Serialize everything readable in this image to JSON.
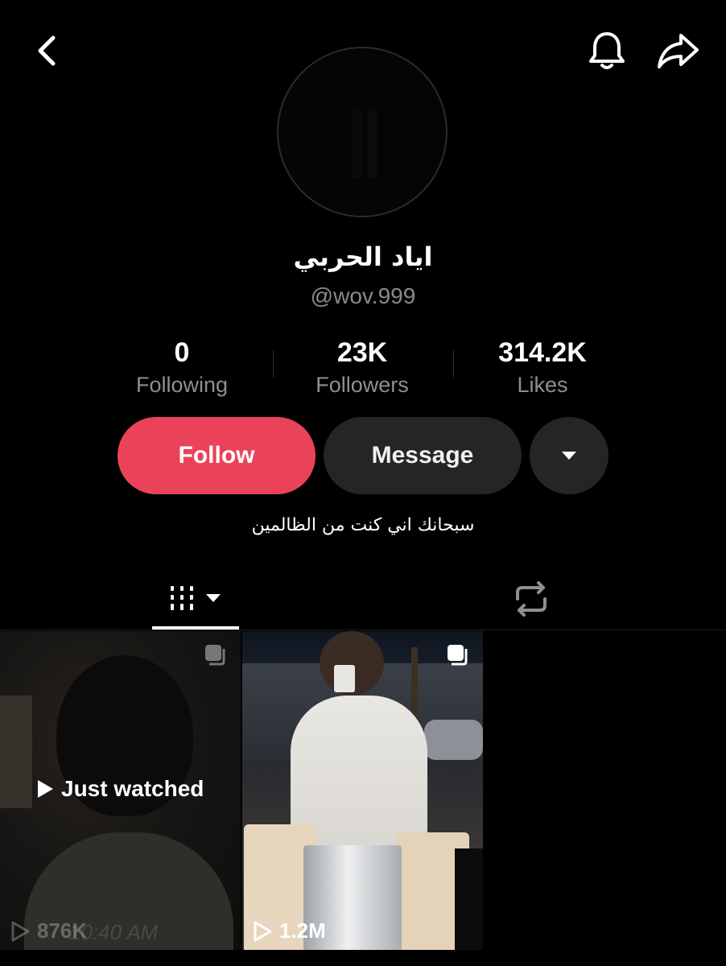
{
  "profile": {
    "display_name": "اياد الحربي",
    "username": "@wov.999",
    "bio": "سبحانك اني كنت من الظالمين"
  },
  "stats": {
    "following": {
      "value": "0",
      "label": "Following"
    },
    "followers": {
      "value": "23K",
      "label": "Followers"
    },
    "likes": {
      "value": "314.2K",
      "label": "Likes"
    }
  },
  "actions": {
    "follow_label": "Follow",
    "message_label": "Message",
    "more_icon": "caret-down-icon"
  },
  "topbar": {
    "back_icon": "chevron-left-icon",
    "notify_icon": "bell-icon",
    "share_icon": "share-arrow-icon"
  },
  "tabs": [
    {
      "name": "videos",
      "icon": "grid-dropdown-icon",
      "selected": true
    },
    {
      "name": "reposts",
      "icon": "repost-icon",
      "selected": false
    }
  ],
  "videos": [
    {
      "views": "876K",
      "badge": "Just watched",
      "timestamp_overlay": "10:40 AM"
    },
    {
      "views": "1.2M"
    }
  ],
  "colors": {
    "background": "#000000",
    "follow_button": "#ea4359",
    "secondary_button": "#252525",
    "muted_text": "#8f8f8f"
  }
}
